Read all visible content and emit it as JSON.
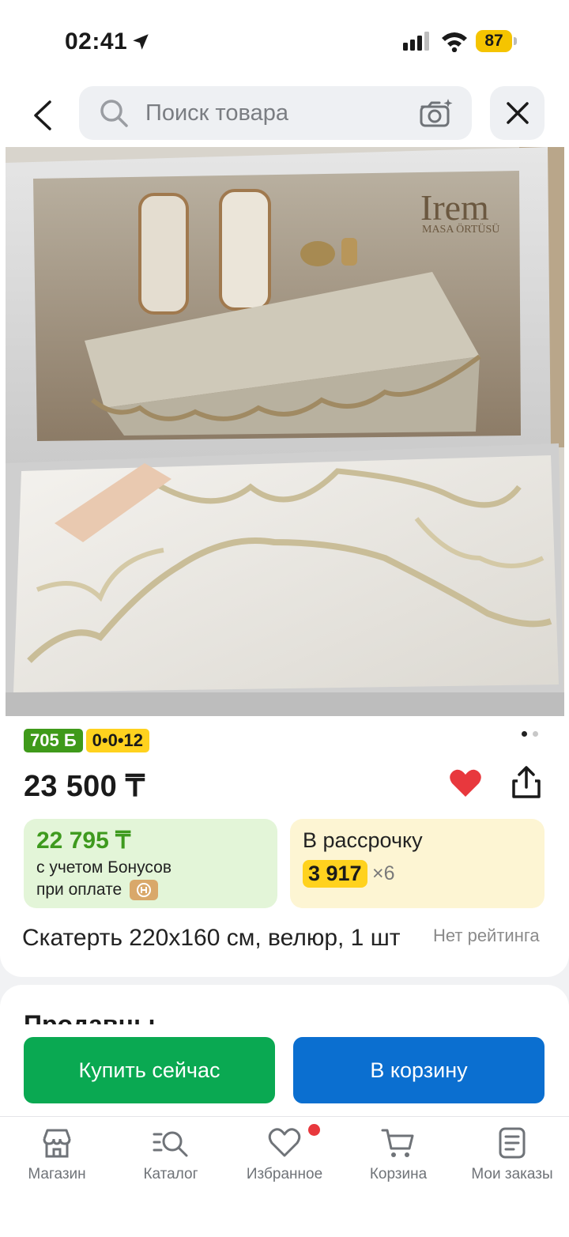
{
  "status": {
    "time": "02:41",
    "battery": "87"
  },
  "search": {
    "placeholder": "Поиск товара"
  },
  "badges": {
    "bonus": "705 Б",
    "installment": "0•0•12"
  },
  "product": {
    "price": "23 500 ₸",
    "title": "Скатерть 220х160 см, велюр, 1 шт",
    "rating": "Нет рейтинга",
    "image_text": {
      "brand": "Irem",
      "subtitle": "MASA ÖRTÜSÜ"
    },
    "image_count": 2,
    "image_index": 1
  },
  "bonus_offer": {
    "price": "22 795 ₸",
    "line1": "с учетом Бонусов",
    "line2": "при оплате"
  },
  "installment_offer": {
    "title": "В рассрочку",
    "amount": "3 917",
    "multiplier": "×6"
  },
  "sellers": {
    "title": "Продавцы"
  },
  "actions": {
    "buy_now": "Купить сейчас",
    "add_to_cart": "В корзину"
  },
  "tabs": [
    {
      "label": "Магазин",
      "icon": "store-icon"
    },
    {
      "label": "Каталог",
      "icon": "catalog-icon"
    },
    {
      "label": "Избранное",
      "icon": "heart-icon"
    },
    {
      "label": "Корзина",
      "icon": "cart-icon"
    },
    {
      "label": "Мои заказы",
      "icon": "orders-icon"
    }
  ],
  "colors": {
    "bonus_green": "#3f9a1a",
    "installment_yellow": "#ffd21e",
    "buy_green": "#0aa952",
    "cart_blue": "#0b6fd0",
    "favorite_red": "#e8383d"
  }
}
